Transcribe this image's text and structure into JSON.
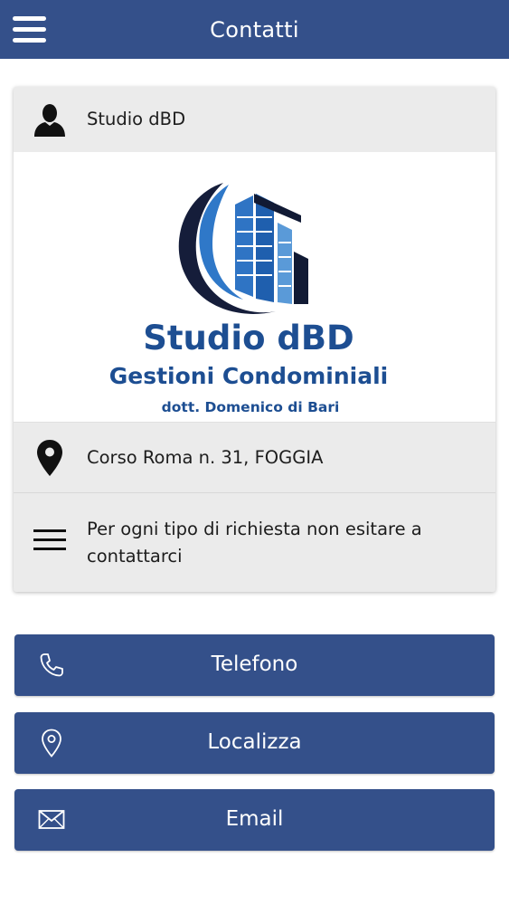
{
  "header": {
    "title": "Contatti",
    "menu_icon": "hamburger-menu-icon"
  },
  "contact_card": {
    "name": "Studio dBD",
    "name_icon": "person-icon",
    "logo": {
      "line1": "Studio dBD",
      "line2": "Gestioni Condominiali",
      "line3": "dott. Domenico di Bari"
    },
    "address": "Corso Roma n. 31, FOGGIA",
    "address_icon": "map-pin-icon",
    "note": "Per ogni tipo di richiesta non esitare a contattarci",
    "note_icon": "lines-icon"
  },
  "actions": [
    {
      "label": "Telefono",
      "icon": "phone-icon"
    },
    {
      "label": "Localizza",
      "icon": "location-pin-icon"
    },
    {
      "label": "Email",
      "icon": "envelope-icon"
    }
  ],
  "colors": {
    "primary": "#34508a",
    "card_bg": "#ebebeb",
    "logo_blue": "#1f5fae",
    "logo_dark": "#0e2f6b"
  }
}
